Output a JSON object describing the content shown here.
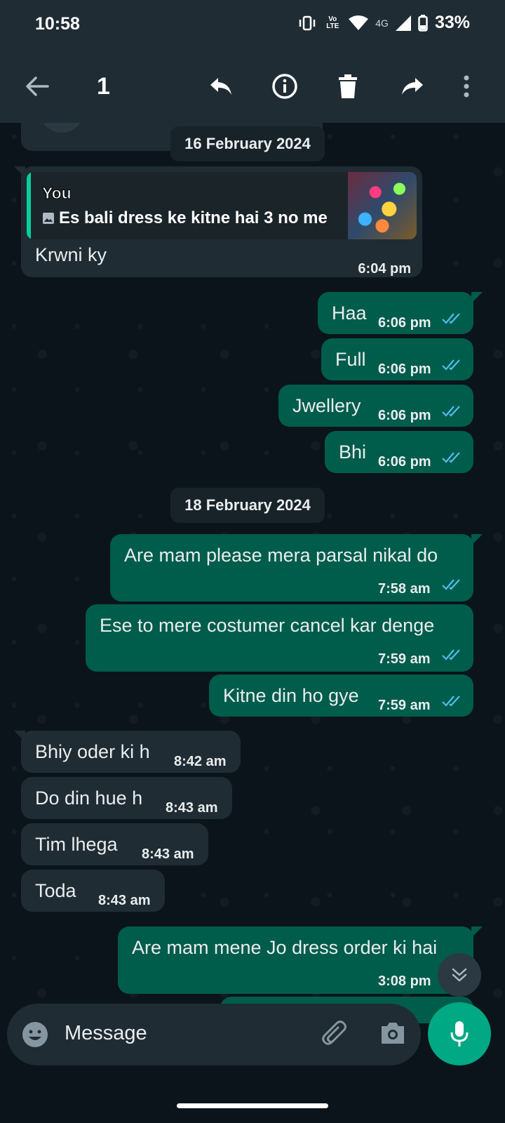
{
  "status_bar": {
    "time": "10:58",
    "network": "4G",
    "volte": "Vo LTE",
    "battery": "33%"
  },
  "toolbar": {
    "selected_count": "1"
  },
  "dates": {
    "first": "16 February 2024",
    "second": "18 February 2024"
  },
  "messages": [
    {
      "text": "Krwni ky",
      "time": "6:04 pm",
      "direction": "in",
      "quote": {
        "sender": "You",
        "text": "Es bali dress ke kitne hai 3 no me"
      }
    },
    {
      "text": "Haa",
      "time": "6:06 pm",
      "direction": "out"
    },
    {
      "text": "Full",
      "time": "6:06 pm",
      "direction": "out"
    },
    {
      "text": "Jwellery",
      "time": "6:06 pm",
      "direction": "out"
    },
    {
      "text": "Bhi",
      "time": "6:06 pm",
      "direction": "out"
    },
    {
      "text": "Are mam please mera parsal nikal do",
      "time": "7:58 am",
      "direction": "out"
    },
    {
      "text": "Ese to mere costumer cancel kar denge",
      "time": "7:59 am",
      "direction": "out"
    },
    {
      "text": "Kitne din ho gye",
      "time": "7:59 am",
      "direction": "out"
    },
    {
      "text": "Bhiy oder ki h",
      "time": "8:42 am",
      "direction": "in"
    },
    {
      "text": "Do din hue h",
      "time": "8:43 am",
      "direction": "in"
    },
    {
      "text": "Tim lhega",
      "time": "8:43 am",
      "direction": "in"
    },
    {
      "text": "Toda",
      "time": "8:43 am",
      "direction": "in"
    },
    {
      "text": "Are mam mene Jo dress order ki hai",
      "time": "3:08 pm",
      "direction": "out"
    }
  ],
  "composer": {
    "placeholder": "Message"
  },
  "colors": {
    "header": "#1f2c34",
    "background": "#0b141a",
    "incoming": "#202c33",
    "outgoing": "#005c4b",
    "accent": "#00a884",
    "read_ticks": "#53bdeb"
  }
}
